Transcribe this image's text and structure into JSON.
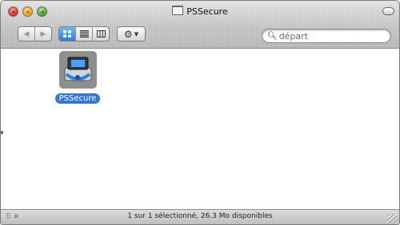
{
  "window": {
    "title": "PSSecure"
  },
  "toolbar": {
    "back_icon": "back-arrow",
    "forward_icon": "forward-arrow",
    "view_icons": [
      "icon-view",
      "list-view",
      "column-view"
    ],
    "selected_view": "icon-view",
    "action_icon": "gear"
  },
  "search": {
    "placeholder": "départ"
  },
  "content": {
    "items": [
      {
        "label": "PSSecure",
        "selected": true
      }
    ]
  },
  "status": {
    "text": "1 sur 1 sélectionné, 26.3 Mo disponibles"
  },
  "colors": {
    "selection": "#3875d7",
    "view_selected": "#2c7be0"
  }
}
